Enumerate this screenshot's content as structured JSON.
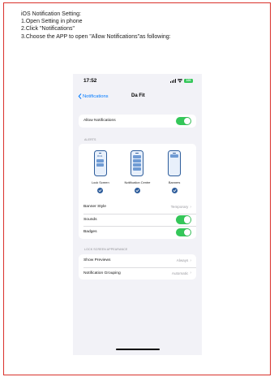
{
  "instructions": {
    "title": "iOS Notification Setting:",
    "step1": "1.Open Setting in phone",
    "step2": "2.Click \"Notifications\"",
    "step3": "3.Choose the APP to open \"Allow Notifications\"as following:"
  },
  "phone": {
    "status_bar": {
      "time": "17:52",
      "battery": "100"
    },
    "nav": {
      "back_label": "Notifications",
      "title": "Da Fit"
    },
    "allow_notifications": {
      "label": "Allow Notifications",
      "on": true
    },
    "alerts": {
      "header": "ALERTS",
      "options": [
        {
          "label": "Lock Screen",
          "checked": true
        },
        {
          "label": "Notification Centre",
          "checked": true
        },
        {
          "label": "Banners",
          "checked": true
        }
      ],
      "lock_screen_time": "09:41",
      "banner_style": {
        "label": "Banner Style",
        "value": "Temporary"
      },
      "sounds": {
        "label": "Sounds",
        "on": true
      },
      "badges": {
        "label": "Badges",
        "on": true
      }
    },
    "lock_screen_appearance": {
      "header": "LOCK SCREEN APPEARANCE",
      "show_previews": {
        "label": "Show Previews",
        "value": "Always"
      },
      "grouping": {
        "label": "Notification Grouping",
        "value": "Automatic"
      }
    }
  },
  "colors": {
    "frame": "#d9312b",
    "toggle_on": "#34c759",
    "ios_blue": "#007aff",
    "alert_blue": "#2e5d9b"
  },
  "icons": [
    "signal-icon",
    "wifi-icon",
    "battery-icon",
    "back-chevron-icon",
    "chevron-right-icon",
    "checkmark-icon"
  ]
}
